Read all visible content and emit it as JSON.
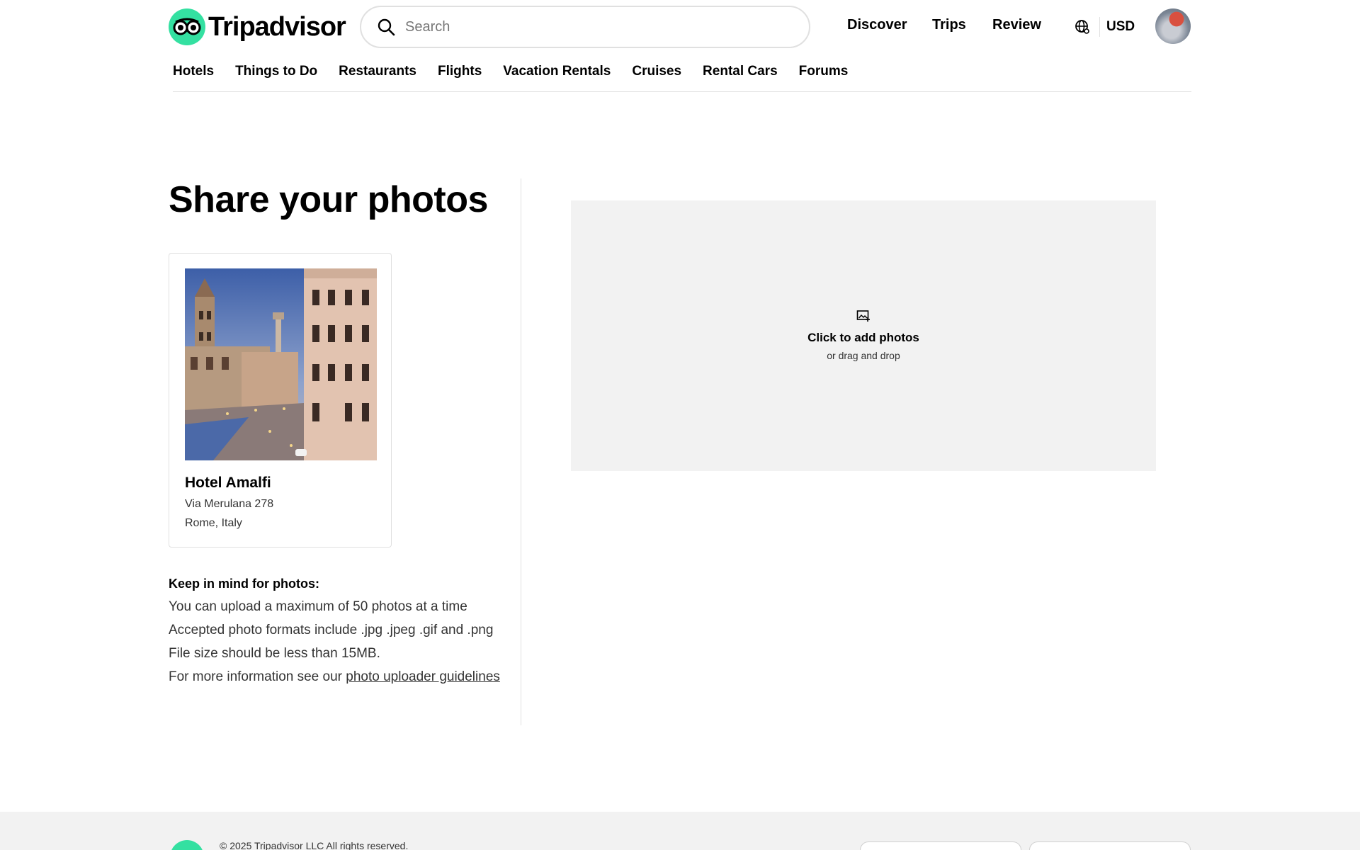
{
  "header": {
    "logo_text": "Tripadvisor",
    "search_placeholder": "Search",
    "nav": [
      "Discover",
      "Trips",
      "Review"
    ],
    "currency": "USD"
  },
  "sub_nav": [
    "Hotels",
    "Things to Do",
    "Restaurants",
    "Flights",
    "Vacation Rentals",
    "Cruises",
    "Rental Cars",
    "Forums"
  ],
  "main": {
    "title": "Share your photos",
    "hotel": {
      "name": "Hotel Amalfi",
      "address": "Via Merulana 278",
      "city": "Rome, Italy"
    },
    "tips_title": "Keep in mind for photos:",
    "tips": [
      "You can upload a maximum of 50 photos at a time",
      "Accepted photo formats include .jpg .jpeg .gif and .png",
      "File size should be less than 15MB."
    ],
    "more_info_prefix": "For more information see our ",
    "more_info_link": "photo uploader guidelines",
    "upload_title": "Click to add photos",
    "upload_subtitle": "or drag and drop"
  },
  "footer": {
    "copyright": "© 2025 Tripadvisor LLC All rights reserved."
  },
  "colors": {
    "brand": "#34e0a1",
    "upload_bg": "#f2f2f2",
    "border": "#e0e0e0"
  }
}
